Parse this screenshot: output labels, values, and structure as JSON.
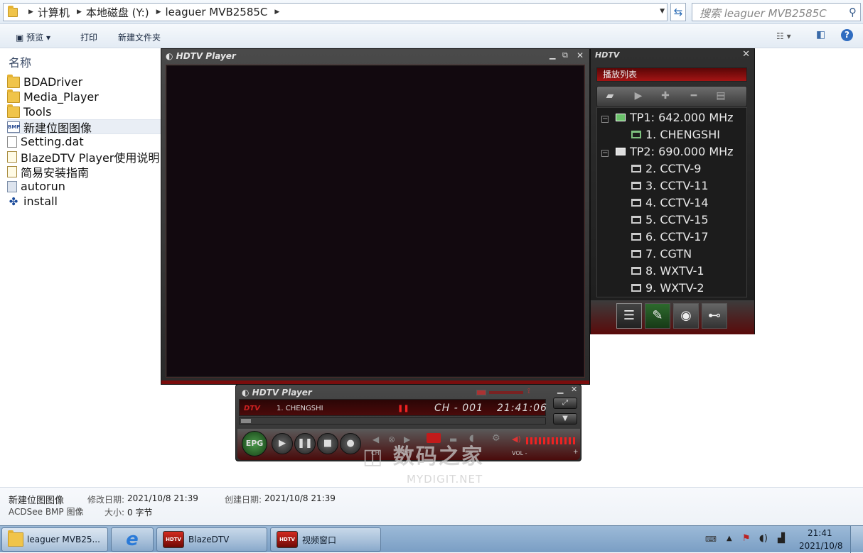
{
  "address": {
    "segments": [
      "计算机",
      "本地磁盘 (Y:)",
      "leaguer MVB2585C"
    ],
    "search_placeholder": "搜索 leaguer MVB2585C"
  },
  "toolbar": {
    "preview": "预览",
    "print": "打印",
    "new_folder": "新建文件夹"
  },
  "file_list": {
    "column_name": "名称",
    "items": [
      {
        "name": "BDADriver",
        "icon": "folder-icon"
      },
      {
        "name": "Media_Player",
        "icon": "folder-icon"
      },
      {
        "name": "Tools",
        "icon": "folder-icon"
      },
      {
        "name": "新建位图图像",
        "icon": "bmp-file-icon",
        "selected": true
      },
      {
        "name": "Setting.dat",
        "icon": "file-icon"
      },
      {
        "name": "BlazeDTV Player使用说明",
        "icon": "document-icon"
      },
      {
        "name": "简易安装指南",
        "icon": "document-icon"
      },
      {
        "name": "autorun",
        "icon": "autorun-icon"
      },
      {
        "name": "install",
        "icon": "installer-icon"
      }
    ]
  },
  "player_window": {
    "title": "HDTV Player"
  },
  "playlist_panel": {
    "title": "HDTV",
    "header": "播放列表",
    "transponders": [
      {
        "label": "TP1: 642.000 MHz",
        "channels": [
          "1. CHENGSHI"
        ]
      },
      {
        "label": "TP2: 690.000 MHz",
        "channels": [
          "2. CCTV-9",
          "3. CCTV-11",
          "4. CCTV-14",
          "5. CCTV-15",
          "6. CCTV-17",
          "7. CGTN",
          "8. WXTV-1",
          "9. WXTV-2"
        ]
      }
    ]
  },
  "control_window": {
    "title": "HDTV Player",
    "mode": "DTV",
    "channel": "1. CHENGSHI",
    "ch_number": "CH - 001",
    "time": "21:41:06",
    "epg_label": "EPG",
    "ch_label": "CH",
    "vol_label": "VOL -",
    "vol_plus": "+"
  },
  "status_bar": {
    "file_name": "新建位图图像",
    "file_type": "ACDSee BMP 图像",
    "modified_label": "修改日期:",
    "modified_value": "2021/10/8 21:39",
    "created_label": "创建日期:",
    "created_value": "2021/10/8 21:39",
    "size_label": "大小:",
    "size_value": "0 字节"
  },
  "taskbar": {
    "tasks": [
      "leaguer MVB25...",
      "BlazeDTV",
      "视频窗口"
    ],
    "clock_time": "21:41",
    "clock_date": "2021/10/8"
  },
  "watermark": {
    "text": "数码之家",
    "sub": "MYDIGIT.NET"
  },
  "colors": {
    "player_red": "#7a0d0d",
    "player_dark": "#12090f",
    "selection": "#e9eef5",
    "taskbar": "#8fb0d2"
  }
}
